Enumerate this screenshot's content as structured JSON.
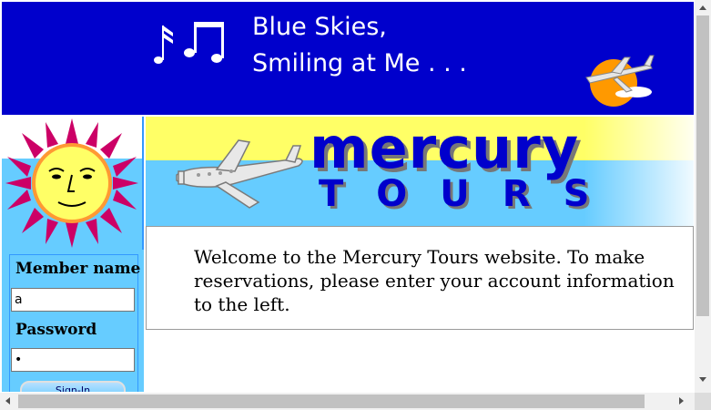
{
  "banner": {
    "line1": "Blue Skies,",
    "line2": "Smiling at Me . . ."
  },
  "logo": {
    "word1": "mercury",
    "word2": "TOURS"
  },
  "login": {
    "member_label": "Member name",
    "member_value": "a",
    "password_label": "Password",
    "password_value": "•",
    "signin_label": "Sign-In"
  },
  "welcome": {
    "text": "Welcome to the Mercury Tours website. To make reservations, please enter your account information to the left."
  },
  "colors": {
    "banner_bg": "#0000cc",
    "left_bg": "#66ccff",
    "logo_yellow": "#ffff66",
    "logo_text": "#0000cc"
  }
}
